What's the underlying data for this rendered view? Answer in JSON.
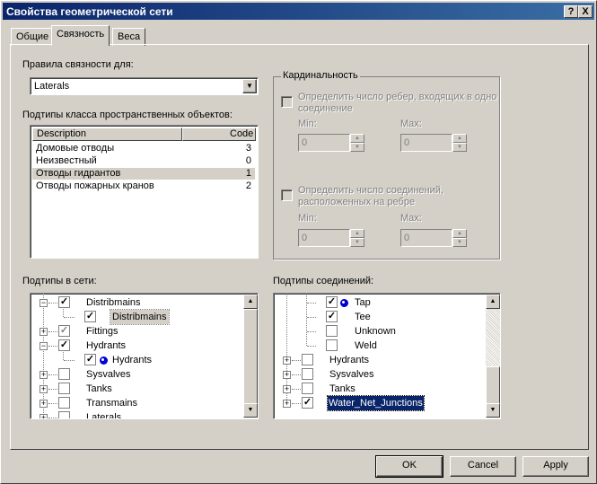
{
  "window": {
    "title": "Свойства геометрической сети",
    "help_btn": "?",
    "close_btn": "X"
  },
  "tabs": [
    {
      "label": "Общие",
      "active": false
    },
    {
      "label": "Связность",
      "active": true
    },
    {
      "label": "Веса",
      "active": false
    }
  ],
  "rules": {
    "label": "Правила связности для:",
    "value": "Laterals"
  },
  "subtypes_class": {
    "label": "Подтипы класса пространственных объектов:",
    "columns": [
      "Description",
      "Code"
    ],
    "rows": [
      {
        "description": "Домовые отводы",
        "code": "3"
      },
      {
        "description": "Неизвестный",
        "code": "0"
      },
      {
        "description": "Отводы гидрантов",
        "code": "1"
      },
      {
        "description": "Отводы пожарных кранов",
        "code": "2"
      }
    ],
    "selected_index": 2
  },
  "cardinality": {
    "label": "Кардинальность",
    "edge_check_line1": "Определить число ребер, входящих в одно",
    "edge_check_line2": "соединение",
    "junction_check_line1": "Определить число соединений,",
    "junction_check_line2": "расположенных на ребре",
    "min_label": "Min:",
    "max_label": "Max:",
    "edge_min": "0",
    "edge_max": "0",
    "junction_min": "0",
    "junction_max": "0"
  },
  "network_subtypes": {
    "label": "Подтипы в сети:",
    "items": [
      {
        "label": "Distribmains",
        "level": 0,
        "expander": "-",
        "checked": true,
        "grey": false
      },
      {
        "label": "Distribmains",
        "level": 1,
        "checked": true,
        "grey": false,
        "boxed": true
      },
      {
        "label": "Fittings",
        "level": 0,
        "expander": "+",
        "checked": true,
        "grey": true
      },
      {
        "label": "Hydrants",
        "level": 0,
        "expander": "-",
        "checked": true,
        "grey": false
      },
      {
        "label": "Hydrants",
        "level": 1,
        "checked": true,
        "grey": false,
        "icon": true
      },
      {
        "label": "Sysvalves",
        "level": 0,
        "expander": "+",
        "checked": false,
        "grey": false
      },
      {
        "label": "Tanks",
        "level": 0,
        "expander": "+",
        "checked": false,
        "grey": false
      },
      {
        "label": "Transmains",
        "level": 0,
        "expander": "+",
        "checked": false,
        "grey": false
      },
      {
        "label": "Laterals",
        "level": 0,
        "expander": "+",
        "checked": false,
        "grey": false
      }
    ]
  },
  "junction_subtypes": {
    "label": "Подтипы соединений:",
    "items": [
      {
        "label": "Tap",
        "level": 1,
        "checked": true,
        "icon": true
      },
      {
        "label": "Tee",
        "level": 1,
        "checked": true
      },
      {
        "label": "Unknown",
        "level": 1,
        "checked": false
      },
      {
        "label": "Weld",
        "level": 1,
        "checked": false
      },
      {
        "label": "Hydrants",
        "level": 0,
        "expander": "+",
        "checked": false
      },
      {
        "label": "Sysvalves",
        "level": 0,
        "expander": "+",
        "checked": false
      },
      {
        "label": "Tanks",
        "level": 0,
        "expander": "+",
        "checked": false
      },
      {
        "label": "Water_Net_Junctions",
        "level": 0,
        "expander": "+",
        "checked": true,
        "selected": true
      }
    ]
  },
  "buttons": {
    "ok": "OK",
    "cancel": "Cancel",
    "apply": "Apply"
  }
}
